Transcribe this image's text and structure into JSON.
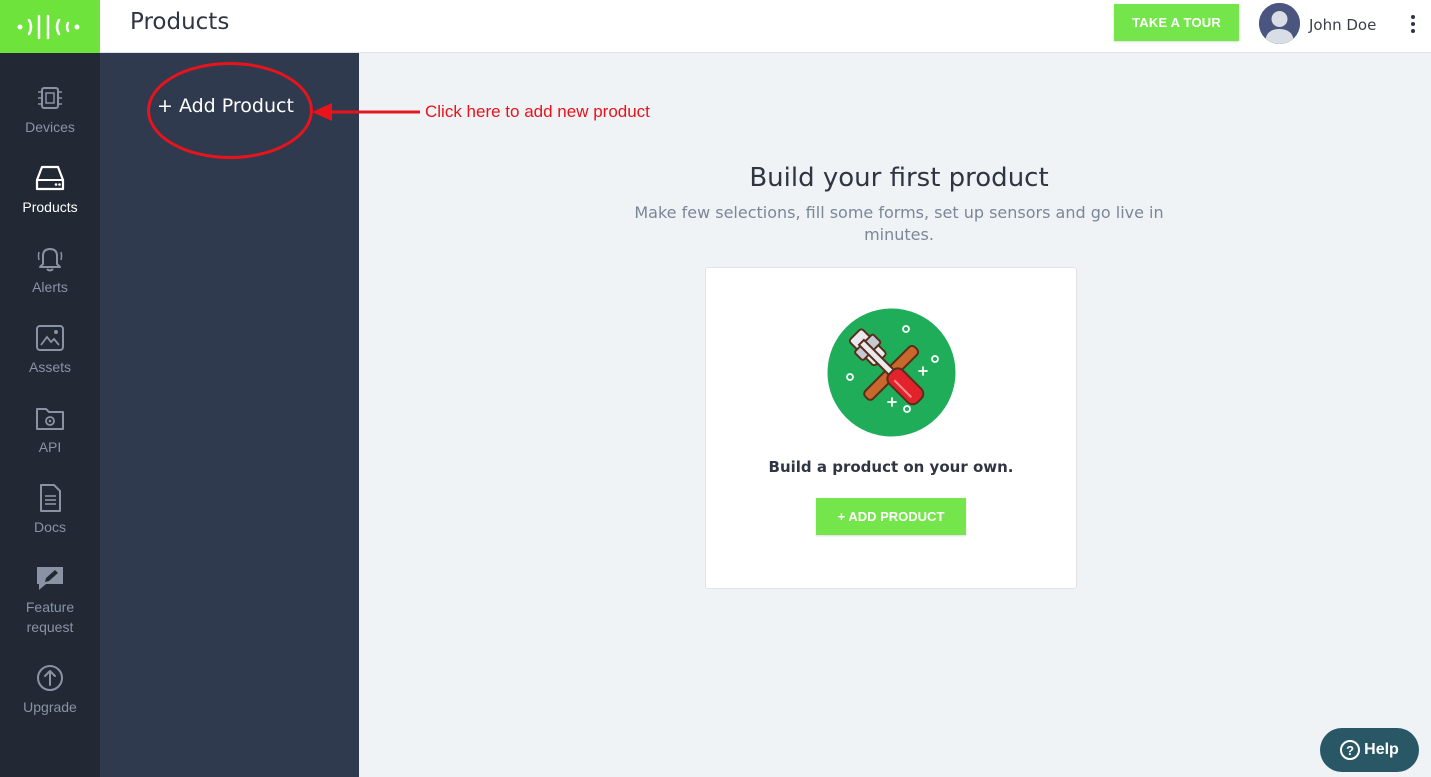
{
  "header": {
    "title": "Products",
    "tour_button": "TAKE A TOUR",
    "user_name": "John Doe"
  },
  "rail": {
    "items": [
      {
        "label": "Devices",
        "icon": "chip-icon"
      },
      {
        "label": "Products",
        "icon": "drive-icon"
      },
      {
        "label": "Alerts",
        "icon": "bell-icon"
      },
      {
        "label": "Assets",
        "icon": "image-icon"
      },
      {
        "label": "API",
        "icon": "folder-gear-icon"
      },
      {
        "label": "Docs",
        "icon": "document-icon"
      },
      {
        "label": "Feature request",
        "icon": "feedback-icon"
      },
      {
        "label": "Upgrade",
        "icon": "upgrade-icon"
      }
    ]
  },
  "subnav": {
    "add_product": "+ Add Product"
  },
  "annotation": {
    "text": "Click here to add new product",
    "color": "#e8131b"
  },
  "main": {
    "title": "Build your first product",
    "subtitle": "Make few selections, fill some forms, set up sensors and go live in minutes.",
    "card": {
      "text": "Build a product on your own.",
      "button": "+ ADD PRODUCT"
    }
  },
  "help": {
    "label": "Help"
  },
  "colors": {
    "accent": "#74e54a",
    "rail_bg": "#222935",
    "subnav_bg": "#2f3a4e",
    "help_bg": "#2a5766"
  }
}
